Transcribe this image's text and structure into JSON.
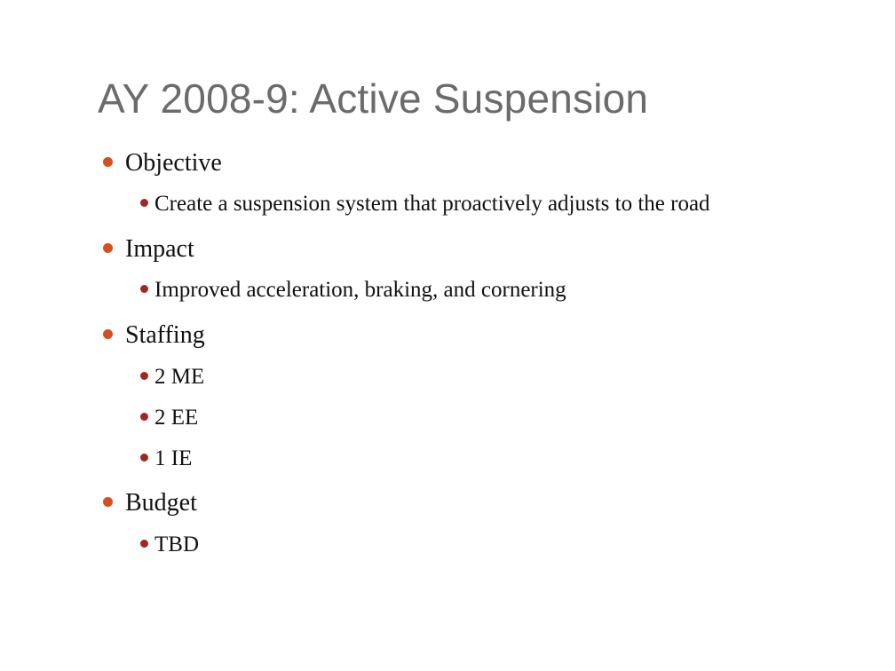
{
  "slide": {
    "title": "AY 2008-9: Active Suspension",
    "bullet_color_level1": "#d6501e",
    "bullet_color_level2": "#9c2a20",
    "items": [
      {
        "label": "Objective",
        "children": [
          {
            "label": "Create a suspension system that proactively adjusts to the road"
          }
        ]
      },
      {
        "label": "Impact",
        "children": [
          {
            "label": "Improved acceleration, braking, and cornering"
          }
        ]
      },
      {
        "label": "Staffing",
        "children": [
          {
            "label": "2 ME"
          },
          {
            "label": "2 EE"
          },
          {
            "label": "1 IE"
          }
        ]
      },
      {
        "label": "Budget",
        "children": [
          {
            "label": "TBD"
          }
        ]
      }
    ]
  }
}
